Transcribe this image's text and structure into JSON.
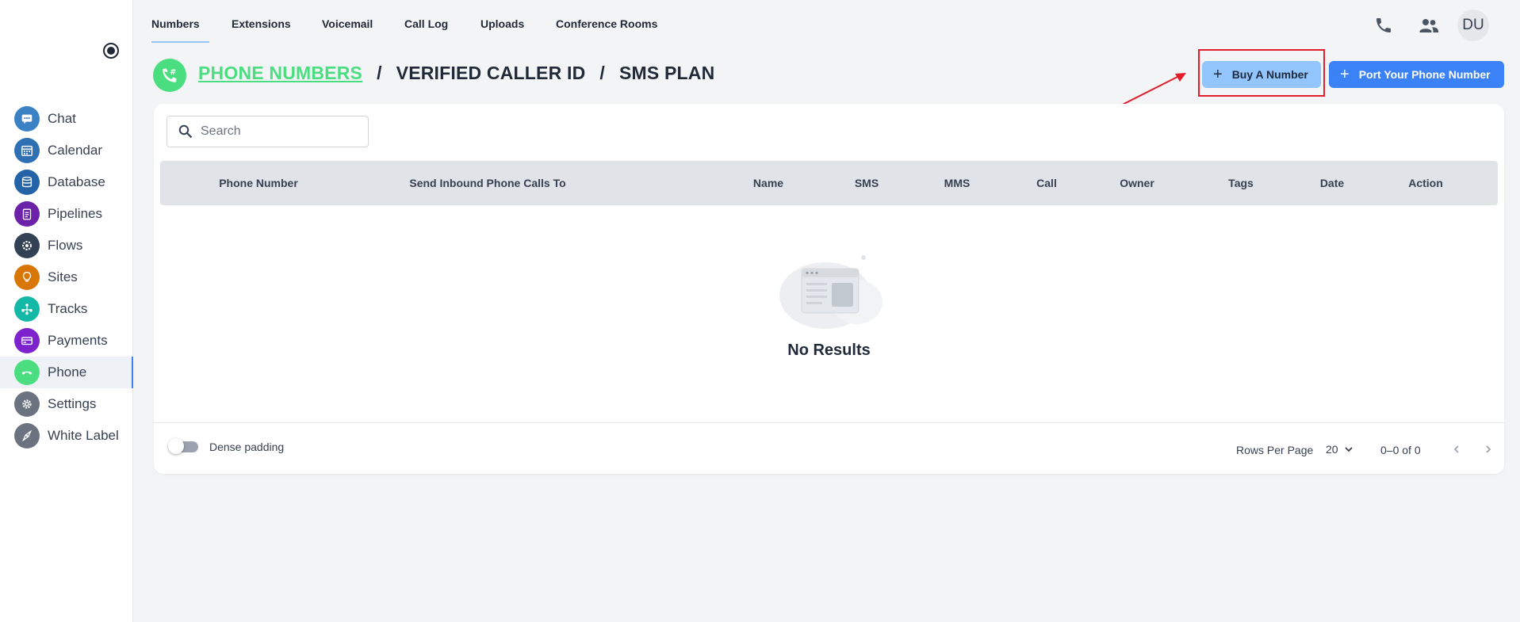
{
  "sidebar": {
    "items": [
      {
        "label": "Chat",
        "icon": "chat-icon",
        "color": "#3b82c4"
      },
      {
        "label": "Calendar",
        "icon": "calendar-icon",
        "color": "#2f6fb3"
      },
      {
        "label": "Database",
        "icon": "database-icon",
        "color": "#2563a8"
      },
      {
        "label": "Pipelines",
        "icon": "clipboard-icon",
        "color": "#6b21a8"
      },
      {
        "label": "Flows",
        "icon": "gear-flow-icon",
        "color": "#334155"
      },
      {
        "label": "Sites",
        "icon": "idea-icon",
        "color": "#d97706"
      },
      {
        "label": "Tracks",
        "icon": "network-icon",
        "color": "#14b8a6"
      },
      {
        "label": "Payments",
        "icon": "payment-icon",
        "color": "#7e22ce"
      },
      {
        "label": "Phone",
        "icon": "phone-icon",
        "color": "#4ade80"
      },
      {
        "label": "Settings",
        "icon": "settings-icon",
        "color": "#6b7280"
      },
      {
        "label": "White Label",
        "icon": "white-label-icon",
        "color": "#6b7280"
      }
    ],
    "active": "Phone"
  },
  "topnav": {
    "tabs": [
      "Numbers",
      "Extensions",
      "Voicemail",
      "Call Log",
      "Uploads",
      "Conference Rooms"
    ],
    "active": "Numbers",
    "avatar": "DU"
  },
  "header": {
    "crumb_active": "PHONE NUMBERS",
    "crumb_2": "VERIFIED CALLER ID",
    "crumb_3": "SMS PLAN",
    "separator": "/"
  },
  "actions": {
    "buy": "Buy A Number",
    "port": "Port Your Phone Number",
    "plus": "+"
  },
  "search": {
    "placeholder": "Search"
  },
  "table": {
    "columns": [
      "Phone Number",
      "Send Inbound Phone Calls To",
      "Name",
      "SMS",
      "MMS",
      "Call",
      "Owner",
      "Tags",
      "Date",
      "Action"
    ],
    "empty_text": "No Results"
  },
  "footer": {
    "dense_label": "Dense padding",
    "rows_per_page_label": "Rows Per Page",
    "rows_per_page": "20",
    "range": "0–0 of 0"
  },
  "colors": {
    "accent": "#3b82f6",
    "phone_green": "#4ade80",
    "highlight": "#e11d2a"
  }
}
